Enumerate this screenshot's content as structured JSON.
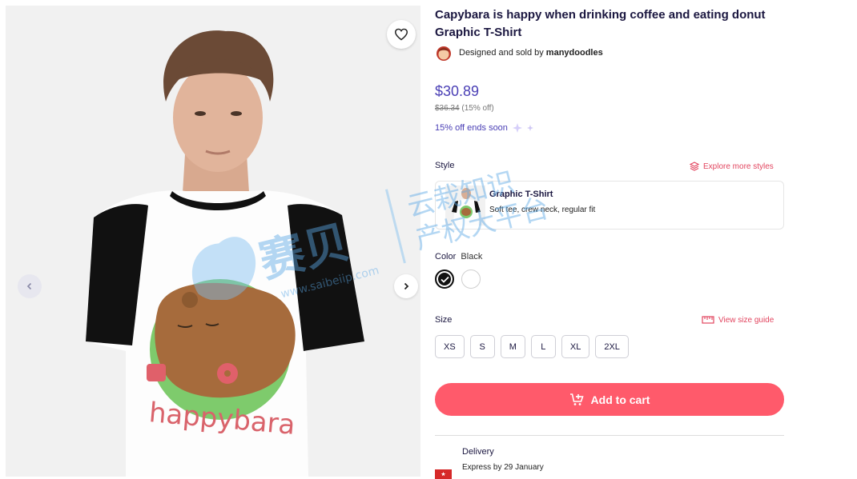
{
  "product": {
    "title_line1": "Capybara is happy when drinking coffee and eating donut",
    "title_line2": "Graphic T-Shirt",
    "designed_by_prefix": "Designed and sold by",
    "seller_name": "manydoodles",
    "price": "$30.89",
    "old_price": "$36.34",
    "discount": "(15% off)",
    "promo": "15% off ends soon",
    "shirt_print_text": "happybara"
  },
  "style": {
    "label": "Style",
    "explore_link": "Explore more styles",
    "selected_name": "Graphic T-Shirt",
    "selected_desc": "Soft tee, crew neck, regular fit"
  },
  "color": {
    "label": "Color",
    "selected": "Black",
    "options": [
      "Black",
      "White"
    ]
  },
  "size": {
    "label": "Size",
    "guide_link": "View size guide",
    "options": [
      "XS",
      "S",
      "M",
      "L",
      "XL",
      "2XL"
    ]
  },
  "cart": {
    "label": "Add to cart"
  },
  "delivery": {
    "title": "Delivery",
    "subtitle": "Express by 29 January"
  },
  "watermark": {
    "brand": "赛贝",
    "line1": "云栽知识",
    "line2": "产权大平台",
    "url": "www.saibeiip.com"
  },
  "colors": {
    "accent": "#4a3fb5",
    "cart": "#ff5a6b",
    "link": "#e2455f"
  },
  "icons": [
    "heart-icon",
    "chevron-left-icon",
    "chevron-right-icon",
    "layers-icon",
    "ruler-icon",
    "cart-icon",
    "sparkle-icon",
    "check-icon",
    "flag-icon"
  ]
}
